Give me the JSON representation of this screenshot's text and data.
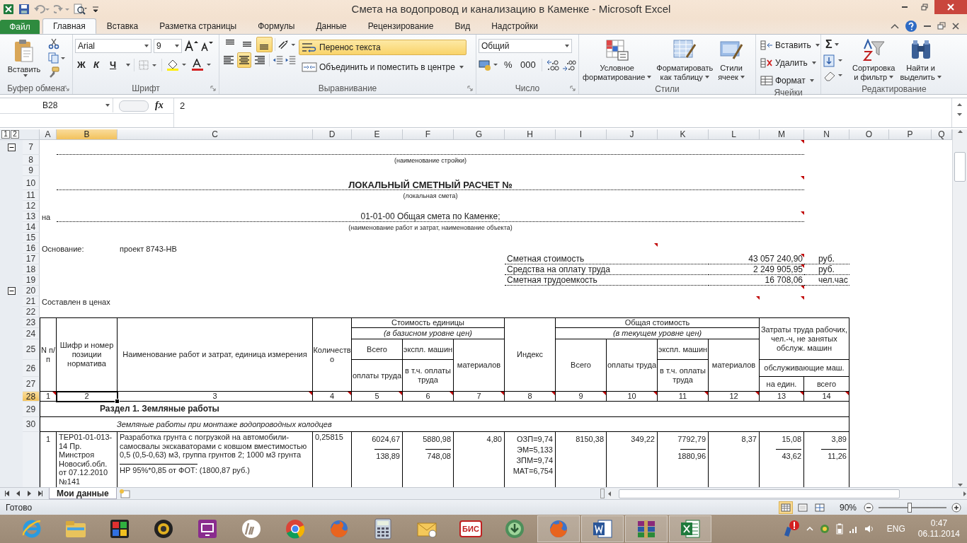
{
  "window": {
    "title": "Смета на водопровод и канализацию в Каменке - Microsoft Excel"
  },
  "ribbon_tabs": [
    {
      "label": "Файл",
      "kind": "file",
      "selected": false
    },
    {
      "label": "Главная",
      "kind": "tab",
      "selected": true
    },
    {
      "label": "Вставка",
      "kind": "tab",
      "selected": false
    },
    {
      "label": "Разметка страницы",
      "kind": "tab",
      "selected": false
    },
    {
      "label": "Формулы",
      "kind": "tab",
      "selected": false
    },
    {
      "label": "Данные",
      "kind": "tab",
      "selected": false
    },
    {
      "label": "Рецензирование",
      "kind": "tab",
      "selected": false
    },
    {
      "label": "Вид",
      "kind": "tab",
      "selected": false
    },
    {
      "label": "Надстройки",
      "kind": "tab",
      "selected": false
    }
  ],
  "ribbon": {
    "clipboard": {
      "paste": "Вставить",
      "group": "Буфер обмена"
    },
    "font": {
      "family": "Arial",
      "size": "9",
      "bold": "Ж",
      "italic": "К",
      "underline": "Ч",
      "group": "Шрифт"
    },
    "alignment": {
      "vertical": [
        {
          "selected": false
        },
        {
          "selected": false
        },
        {
          "selected": true
        }
      ],
      "horizontal": [
        {
          "selected": false
        },
        {
          "selected": true
        },
        {
          "selected": false
        }
      ],
      "wrap_text": {
        "label": "Перенос текста",
        "selected": true
      },
      "merge": "Объединить и поместить в центре",
      "group": "Выравнивание"
    },
    "number": {
      "format": "Общий",
      "percent": "%",
      "thousands": "000",
      "group": "Число"
    },
    "styles": {
      "buttons": [
        {
          "kind": "conditional",
          "lines": [
            "Условное",
            "форматирование"
          ]
        },
        {
          "kind": "table",
          "lines": [
            "Форматировать",
            "как таблицу"
          ]
        },
        {
          "kind": "cell",
          "lines": [
            "Стили",
            "ячеек"
          ]
        }
      ],
      "group": "Стили"
    },
    "cells": {
      "buttons": [
        {
          "kind": "insert",
          "label": "Вставить"
        },
        {
          "kind": "delete",
          "label": "Удалить"
        },
        {
          "kind": "format",
          "label": "Формат"
        }
      ],
      "group": "Ячейки"
    },
    "editing": {
      "sum": "Σ",
      "buttons": [
        {
          "kind": "sort",
          "lines": [
            "Сортировка",
            "и фильтр"
          ]
        },
        {
          "kind": "find",
          "lines": [
            "Найти и",
            "выделить"
          ]
        }
      ],
      "group": "Редактирование"
    }
  },
  "formula_bar": {
    "name_box": "B28",
    "fx": "fx",
    "value": "2"
  },
  "sheet": {
    "outline_levels": [
      "1",
      "2"
    ],
    "outline_groups": [
      {
        "expanded": true
      },
      {
        "expanded": true
      }
    ],
    "columns": [
      {
        "label": "A",
        "selected": false
      },
      {
        "label": "B",
        "selected": true
      },
      {
        "label": "C",
        "selected": false
      },
      {
        "label": "D",
        "selected": false
      },
      {
        "label": "E",
        "selected": false
      },
      {
        "label": "F",
        "selected": false
      },
      {
        "label": "G",
        "selected": false
      },
      {
        "label": "H",
        "selected": false
      },
      {
        "label": "I",
        "selected": false
      },
      {
        "label": "J",
        "selected": false
      },
      {
        "label": "K",
        "selected": false
      },
      {
        "label": "L",
        "selected": false
      },
      {
        "label": "M",
        "selected": false
      },
      {
        "label": "N",
        "selected": false
      },
      {
        "label": "O",
        "selected": false
      },
      {
        "label": "P",
        "selected": false
      },
      {
        "label": "Q",
        "selected": false
      }
    ],
    "rows": [
      {
        "label": "7",
        "selected": false
      },
      {
        "label": "8",
        "selected": false
      },
      {
        "label": "9",
        "selected": false
      },
      {
        "label": "10",
        "selected": false
      },
      {
        "label": "11",
        "selected": false
      },
      {
        "label": "12",
        "selected": false
      },
      {
        "label": "13",
        "selected": false
      },
      {
        "label": "14",
        "selected": false
      },
      {
        "label": "15",
        "selected": false
      },
      {
        "label": "16",
        "selected": false
      },
      {
        "label": "17",
        "selected": false
      },
      {
        "label": "18",
        "selected": false
      },
      {
        "label": "19",
        "selected": false
      },
      {
        "label": "20",
        "selected": false
      },
      {
        "label": "21",
        "selected": false
      },
      {
        "label": "22",
        "selected": false
      },
      {
        "label": "23",
        "selected": false
      },
      {
        "label": "24",
        "selected": false
      },
      {
        "label": "25",
        "selected": false
      },
      {
        "label": "26",
        "selected": false
      },
      {
        "label": "27",
        "selected": false
      },
      {
        "label": "28",
        "selected": true
      },
      {
        "label": "29",
        "selected": false
      },
      {
        "label": "30",
        "selected": false
      }
    ],
    "cells": [
      {
        "kind": "line",
        "comment": true
      },
      {
        "kind": "caption",
        "text": "(наименование стройки)",
        "comment": false
      },
      {
        "kind": "title",
        "text": "ЛОКАЛЬНЫЙ СМЕТНЫЙ РАСЧЕТ  №",
        "comment": true
      },
      {
        "kind": "caption",
        "text": "(локальная смета)",
        "comment": false
      },
      {
        "kind": "label",
        "text": "на",
        "comment": false
      },
      {
        "kind": "heading",
        "text": "01-01-00 Общая смета по Каменке;",
        "comment": true
      },
      {
        "kind": "caption",
        "text": "(наименование работ и затрат, наименование объекта)",
        "comment": false
      },
      {
        "kind": "label",
        "text": "Основание:",
        "comment": false
      },
      {
        "kind": "label",
        "text": "проект 8743-НВ",
        "comment": false
      },
      {
        "kind": "empty",
        "comment": true
      },
      {
        "kind": "sumlabel",
        "text": "Сметная стоимость",
        "comment": false
      },
      {
        "kind": "sumvalue",
        "text": "43 057 240,90",
        "comment": true
      },
      {
        "kind": "sumunit",
        "text": "руб.",
        "comment": false
      },
      {
        "kind": "sumlabel",
        "text": "Средства на оплату труда",
        "comment": false
      },
      {
        "kind": "sumvalue",
        "text": "2 249 905,95",
        "comment": true
      },
      {
        "kind": "sumunit",
        "text": "руб.",
        "comment": false
      },
      {
        "kind": "sumlabel",
        "text": "Сметная трудоемкость",
        "comment": false
      },
      {
        "kind": "sumvalue",
        "text": "16 708,06",
        "comment": false
      },
      {
        "kind": "sumunit",
        "text": "чел.час",
        "comment": false
      },
      {
        "kind": "empty",
        "comment": true
      },
      {
        "kind": "label",
        "text": "Составлен в ценах",
        "comment": false
      },
      {
        "kind": "empty",
        "comment": true
      },
      {
        "kind": "empty",
        "comment": true
      },
      {
        "kind": "head",
        "text": "N п/п",
        "comment": false
      },
      {
        "kind": "head",
        "text": "Шифр и номер позиции норматива",
        "comment": false
      },
      {
        "kind": "head",
        "text": "Наименование работ и затрат, единица измерения",
        "comment": false
      },
      {
        "kind": "head",
        "text": "Количество",
        "comment": false
      },
      {
        "kind": "head",
        "text": "Стоимость единицы",
        "comment": false
      },
      {
        "kind": "headi",
        "text": "(в базисном уровне цен)",
        "comment": false
      },
      {
        "kind": "head",
        "text": "Всего",
        "comment": false
      },
      {
        "kind": "head",
        "text": "экспл. машин",
        "comment": false
      },
      {
        "kind": "head",
        "text": "материалов",
        "comment": false
      },
      {
        "kind": "head",
        "text": "оплаты труда",
        "comment": false
      },
      {
        "kind": "head",
        "text": "в т.ч. оплаты труда",
        "comment": false
      },
      {
        "kind": "head",
        "text": "Индекс",
        "comment": false
      },
      {
        "kind": "head",
        "text": "Общая стоимость",
        "comment": false
      },
      {
        "kind": "headi",
        "text": "(в текущем уровне цен)",
        "comment": false
      },
      {
        "kind": "head",
        "text": "Всего",
        "comment": false
      },
      {
        "kind": "head",
        "text": "оплаты труда",
        "comment": false
      },
      {
        "kind": "head",
        "text": "экспл. машин",
        "comment": false
      },
      {
        "kind": "head",
        "text": "в т.ч. оплаты труда",
        "comment": false
      },
      {
        "kind": "head",
        "text": "материалов",
        "comment": false
      },
      {
        "kind": "head",
        "text": "Затраты труда рабочих, чел.-ч, не занятых обслуж. машин",
        "comment": false
      },
      {
        "kind": "head",
        "text": "обслуживающие маш.",
        "comment": false
      },
      {
        "kind": "head",
        "text": "на един.",
        "comment": false
      },
      {
        "kind": "head",
        "text": "всего",
        "comment": false
      },
      {
        "kind": "num",
        "text": "1",
        "comment": true
      },
      {
        "kind": "num",
        "text": "2",
        "comment": false
      },
      {
        "kind": "num",
        "text": "3",
        "comment": true
      },
      {
        "kind": "num",
        "text": "4",
        "comment": true
      },
      {
        "kind": "num",
        "text": "5",
        "comment": true
      },
      {
        "kind": "num",
        "text": "6",
        "comment": true
      },
      {
        "kind": "num",
        "text": "7",
        "comment": true
      },
      {
        "kind": "num",
        "text": "8",
        "comment": true
      },
      {
        "kind": "num",
        "text": "9",
        "comment": true
      },
      {
        "kind": "num",
        "text": "10",
        "comment": true
      },
      {
        "kind": "num",
        "text": "11",
        "comment": true
      },
      {
        "kind": "num",
        "text": "12",
        "comment": true
      },
      {
        "kind": "num",
        "text": "13",
        "comment": true
      },
      {
        "kind": "num",
        "text": "14",
        "comment": true
      },
      {
        "kind": "section",
        "text": "Раздел 1. Земляные работы",
        "comment": false
      },
      {
        "kind": "subsection",
        "text": "Земляные работы при монтаже водопроводных колодцев",
        "comment": false
      },
      {
        "kind": "dcenter",
        "text": "1",
        "comment": false
      },
      {
        "kind": "dleft",
        "text": "ТЕР01-01-013-14 Пр. Минстроя Новосиб.обл. от 07.12.2010 №141",
        "comment": false
      },
      {
        "kind": "dleft",
        "text": "Разработка грунта с погрузкой на автомобили-самосвалы экскаваторами с ковшом вместимостью 0,5 (0,5-0,63) м3, группа грунтов 2; 1000 м3 грунта",
        "below": "НР 95%*0,85 от ФОТ: (1800,87 руб.)",
        "comment": false
      },
      {
        "kind": "dleft",
        "text": "0,25815",
        "comment": false
      },
      {
        "kind": "dright",
        "text": "6024,67",
        "below": "138,89",
        "comment": false
      },
      {
        "kind": "dright",
        "text": "5880,98",
        "below": "748,08",
        "comment": false
      },
      {
        "kind": "dright",
        "text": "4,80",
        "comment": false
      },
      {
        "kind": "dright",
        "text": "ОЗП=9,74\nЭМ=5,133\nЗПМ=9,74\nМАТ=6,754",
        "comment": false
      },
      {
        "kind": "dright",
        "text": "8150,38",
        "comment": false
      },
      {
        "kind": "dright",
        "text": "349,22",
        "comment": false
      },
      {
        "kind": "dright",
        "text": "7792,79",
        "below": "1880,96",
        "comment": false
      },
      {
        "kind": "dright",
        "text": "8,37",
        "comment": false
      },
      {
        "kind": "dright",
        "text": "15,08",
        "below": "43,62",
        "comment": false
      },
      {
        "kind": "dright",
        "text": "3,89",
        "below": "11,26",
        "comment": false
      }
    ]
  },
  "sheet_tabs": [
    {
      "label": "Мои данные",
      "selected": true
    }
  ],
  "status_bar": {
    "text": "Готово",
    "views": [
      {
        "selected": true
      },
      {
        "selected": false
      },
      {
        "selected": false
      }
    ],
    "zoom": "90%",
    "zoom_slider": {
      "level": 0.45
    }
  },
  "taskbar": {
    "apps": [
      {
        "kind": "ie",
        "running": false
      },
      {
        "kind": "explorer",
        "running": false
      },
      {
        "kind": "puzzle",
        "running": false
      },
      {
        "kind": "webcam",
        "running": false
      },
      {
        "kind": "screen",
        "running": false
      },
      {
        "kind": "hp",
        "running": false
      },
      {
        "kind": "chrome",
        "running": false
      },
      {
        "kind": "firefox",
        "running": false
      },
      {
        "kind": "calculator",
        "running": false
      },
      {
        "kind": "mail",
        "running": false
      },
      {
        "kind": "bis",
        "label": "БИС",
        "running": false
      },
      {
        "kind": "update",
        "running": false
      },
      {
        "kind": "firefox",
        "running": true
      },
      {
        "kind": "word",
        "running": true
      },
      {
        "kind": "winrar",
        "running": true
      },
      {
        "kind": "excel",
        "running": true
      }
    ],
    "tray": {
      "language": "ENG",
      "time": "0:47",
      "date": "06.11.2014"
    }
  }
}
